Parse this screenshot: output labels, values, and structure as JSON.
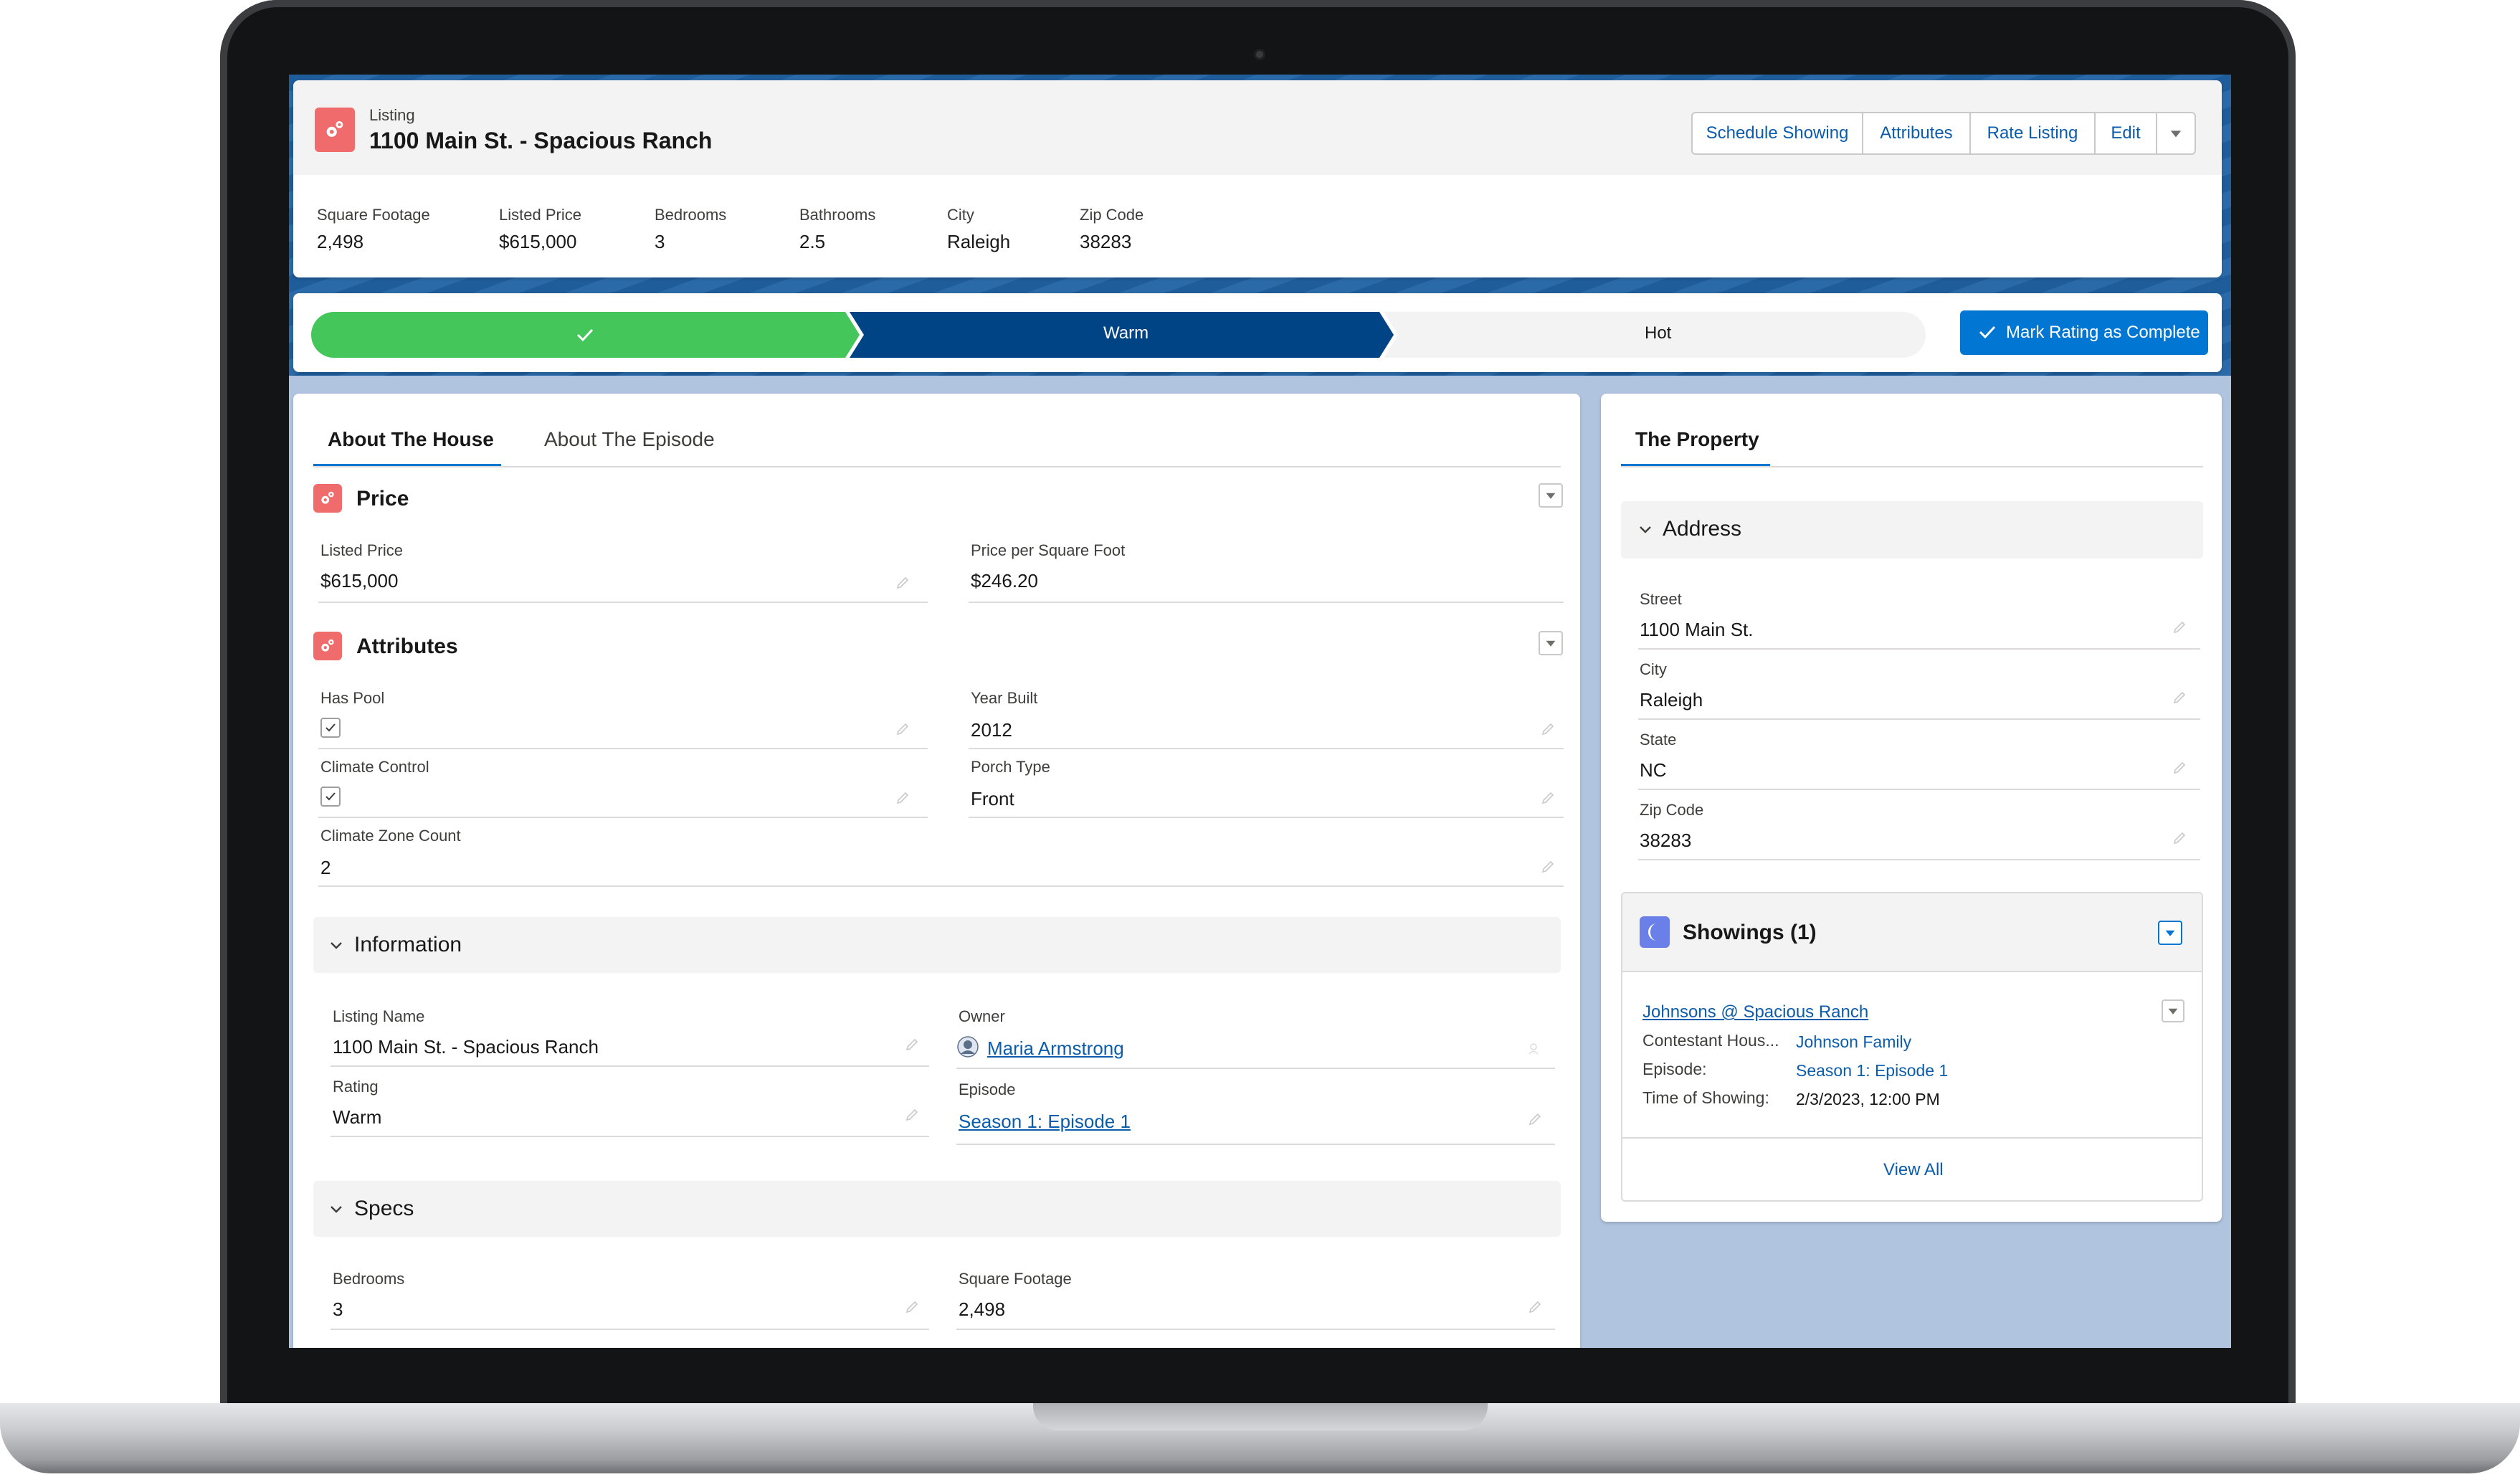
{
  "header": {
    "object_type": "Listing",
    "record_title": "1100 Main St. - Spacious Ranch",
    "actions": [
      "Schedule Showing",
      "Attributes",
      "Rate Listing",
      "Edit"
    ],
    "highlights": [
      {
        "label": "Square Footage",
        "value": "2,498"
      },
      {
        "label": "Listed Price",
        "value": "$615,000"
      },
      {
        "label": "Bedrooms",
        "value": "3"
      },
      {
        "label": "Bathrooms",
        "value": "2.5"
      },
      {
        "label": "City",
        "value": "Raleigh"
      },
      {
        "label": "Zip Code",
        "value": "38283"
      }
    ]
  },
  "path": {
    "stages": [
      {
        "label": "",
        "state": "complete"
      },
      {
        "label": "Warm",
        "state": "current"
      },
      {
        "label": "Hot",
        "state": "upcoming"
      }
    ],
    "complete_button": "Mark Rating as Complete"
  },
  "main": {
    "tabs": [
      "About The House",
      "About The Episode"
    ],
    "active_tab": "About The House",
    "price": {
      "title": "Price",
      "listed_price_label": "Listed Price",
      "listed_price": "$615,000",
      "ppsf_label": "Price per Square Foot",
      "ppsf": "$246.20"
    },
    "attributes": {
      "title": "Attributes",
      "has_pool_label": "Has Pool",
      "has_pool": true,
      "year_built_label": "Year Built",
      "year_built": "2012",
      "climate_control_label": "Climate Control",
      "climate_control": true,
      "porch_type_label": "Porch Type",
      "porch_type": "Front",
      "climate_zone_label": "Climate Zone Count",
      "climate_zone": "2"
    },
    "information": {
      "title": "Information",
      "listing_name_label": "Listing Name",
      "listing_name": "1100 Main St. - Spacious Ranch",
      "owner_label": "Owner",
      "owner": "Maria Armstrong",
      "rating_label": "Rating",
      "rating": "Warm",
      "episode_label": "Episode",
      "episode": "Season 1: Episode 1"
    },
    "specs": {
      "title": "Specs",
      "bedrooms_label": "Bedrooms",
      "bedrooms": "3",
      "sqft_label": "Square Footage",
      "sqft": "2,498"
    }
  },
  "side": {
    "tab": "The Property",
    "address": {
      "title": "Address",
      "street_label": "Street",
      "street": "1100 Main St.",
      "city_label": "City",
      "city": "Raleigh",
      "state_label": "State",
      "state": "NC",
      "zip_label": "Zip Code",
      "zip": "38283"
    },
    "showings": {
      "title": "Showings (1)",
      "record_name": "Johnsons @ Spacious Ranch",
      "contestant_label": "Contestant Hous...",
      "contestant": "Johnson Family",
      "episode_label": "Episode:",
      "episode": "Season 1: Episode 1",
      "time_label": "Time of Showing:",
      "time": "2/3/2023, 12:00 PM",
      "view_all": "View All"
    }
  },
  "colors": {
    "brand_blue": "#0176d3",
    "path_complete": "#45c65a",
    "path_current": "#014486",
    "link": "#0b5cab",
    "listing_icon": "#f06b6b",
    "showings_icon": "#6b7fe8"
  }
}
